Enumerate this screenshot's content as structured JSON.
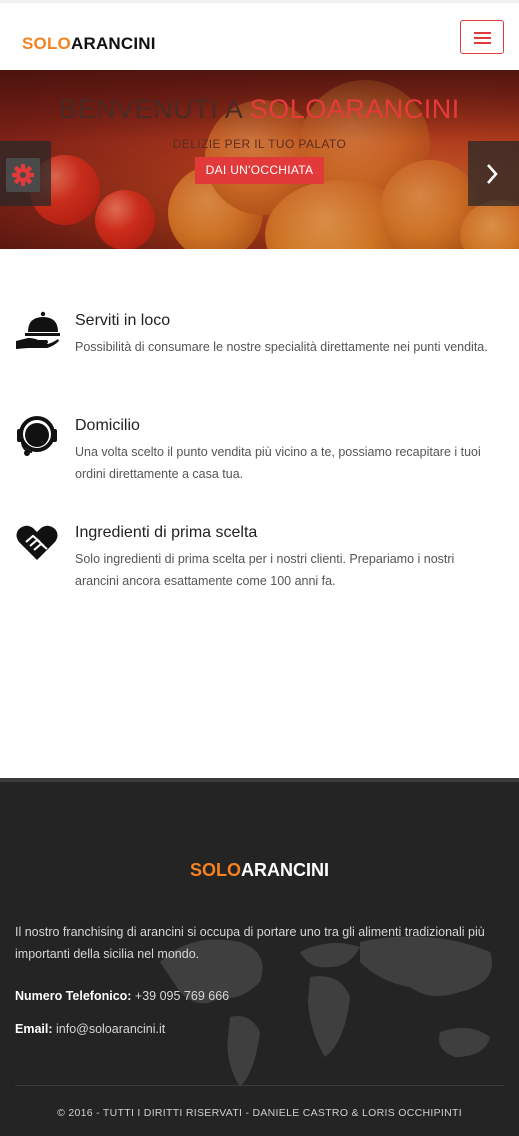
{
  "header": {
    "logo_part1": "SOLO",
    "logo_part2": "ARANCINI",
    "menu_icon": "hamburger-icon"
  },
  "hero": {
    "title_prefix": "BENVENUTI A ",
    "title_accent": "SOLOARANCINI",
    "subtitle": "DELIZIE PER IL TUO PALATO",
    "button_label": "DAI UN'OCCHIATA",
    "prev_icon": "gear-icon",
    "next_icon": "chevron-right-icon"
  },
  "features": [
    {
      "icon": "serving-cloche-icon",
      "title": "Serviti in loco",
      "text": "Possibilità di consumare le nostre specialità direttamente nei punti vendita."
    },
    {
      "icon": "headset-icon",
      "title": "Domicilio",
      "text": "Una volta scelto il punto vendita più vicino a te, possiamo recapitare i tuoi ordini direttamente a casa tua."
    },
    {
      "icon": "handshake-heart-icon",
      "title": "Ingredienti di prima scelta",
      "text": "Solo ingredienti di prima scelta per i nostri clienti. Prepariamo i nostri arancini ancora esattamente come 100 anni fa."
    }
  ],
  "footer": {
    "logo_part1": "SOLO",
    "logo_part2": "ARANCINI",
    "description": "Il nostro franchising di arancini si occupa di portare uno tra gli alimenti tradizionali più importanti della sicilia nel mondo.",
    "phone_label": "Numero Telefonico:",
    "phone_value": " +39 095 769 666",
    "email_label": "Email:",
    "email_value": " info@soloarancini.it",
    "copyright": "© 2016 - TUTTI I DIRITTI RISERVATI - DANIELE CASTRO & LORIS OCCHIPINTI"
  },
  "colors": {
    "accent_orange": "#f5821f",
    "accent_red": "#e23a3a",
    "footer_bg": "#242424"
  }
}
